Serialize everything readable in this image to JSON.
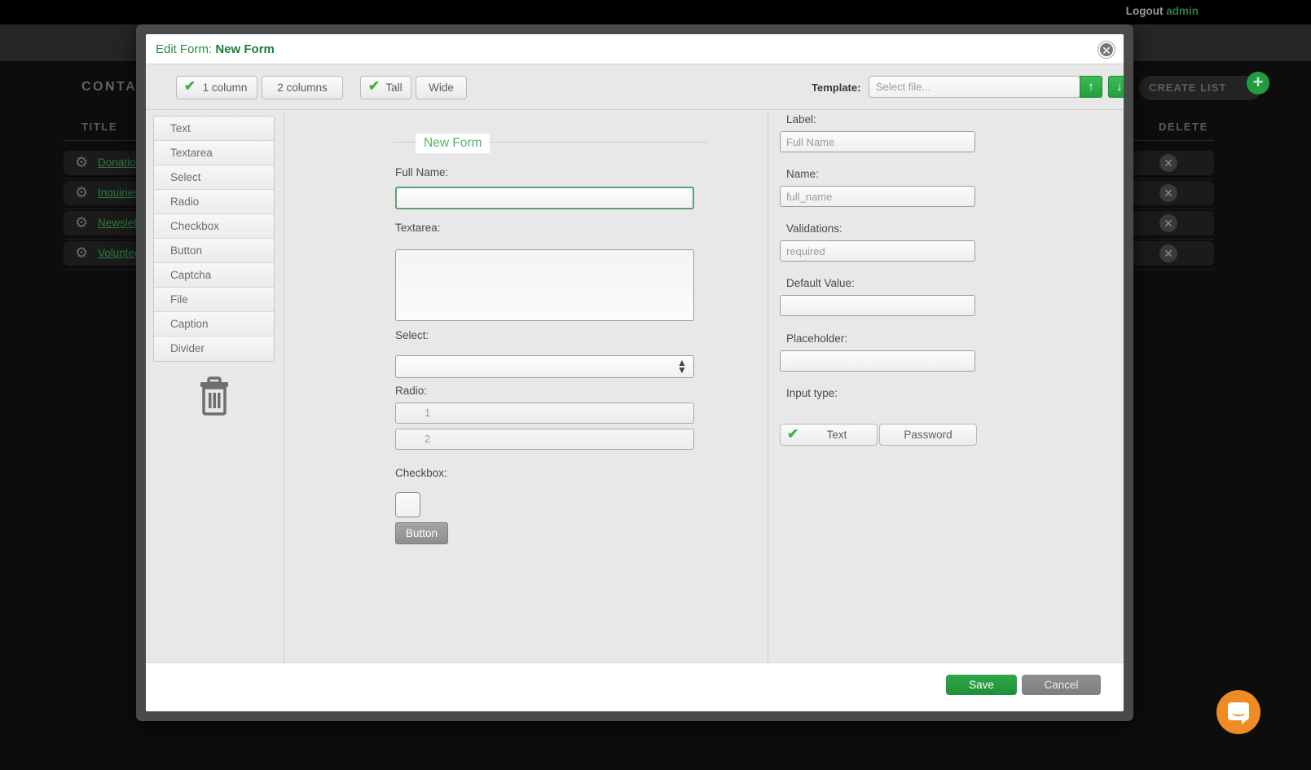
{
  "background": {
    "logout_label": "Logout",
    "username": "admin",
    "page_title": "CONTACT",
    "create_list_label": "CREATE LIST",
    "plus_icon": "plus-icon",
    "columns": {
      "title": "TITLE",
      "delete": "DELETE"
    },
    "rows": [
      {
        "name": "Donation F",
        "gear": "gear-icon",
        "delete": "x"
      },
      {
        "name": "Inquiries",
        "gear": "gear-icon",
        "delete": "x"
      },
      {
        "name": "Newsletter",
        "gear": "gear-icon",
        "delete": "x"
      },
      {
        "name": "Volunteer F",
        "gear": "gear-icon",
        "delete": "x"
      }
    ]
  },
  "modal": {
    "title_prefix": "Edit Form: ",
    "title_value": "New Form",
    "close_icon": "✕",
    "toolbar": {
      "one_column": "1 column",
      "two_columns": "2 columns",
      "tall": "Tall",
      "wide": "Wide",
      "check_glyph": "✔",
      "template_label": "Template:",
      "template_placeholder": "Select file...",
      "template_value": "",
      "upload_icon": "↑",
      "download_icon": "↓"
    },
    "palette": {
      "items": [
        {
          "label": "Text"
        },
        {
          "label": "Textarea"
        },
        {
          "label": "Select"
        },
        {
          "label": "Radio"
        },
        {
          "label": "Checkbox"
        },
        {
          "label": "Button"
        },
        {
          "label": "Captcha"
        },
        {
          "label": "File"
        },
        {
          "label": "Caption"
        },
        {
          "label": "Divider"
        }
      ],
      "trash_icon": "trash-icon"
    },
    "canvas": {
      "legend": "New Form",
      "full_name_label": "Full Name:",
      "full_name_value": "",
      "textarea_label": "Textarea:",
      "textarea_value": "",
      "select_label": "Select:",
      "select_value": "",
      "radio_label": "Radio:",
      "radio_options": [
        "1",
        "2"
      ],
      "checkbox_label": "Checkbox:",
      "button_label": "Button"
    },
    "properties": {
      "label_label": "Label:",
      "label_placeholder": "Full Name",
      "label_value": "",
      "name_label": "Name:",
      "name_placeholder": "full_name",
      "name_value": "",
      "validations_label": "Validations:",
      "validations_placeholder": "required",
      "validations_value": "",
      "default_value_label": "Default Value:",
      "default_value": "",
      "placeholder_label": "Placeholder:",
      "placeholder_value": "",
      "input_type_label": "Input type:",
      "type_text": "Text",
      "type_password": "Password",
      "check_glyph": "✔"
    },
    "footer": {
      "save_label": "Save",
      "cancel_label": "Cancel"
    }
  },
  "chat": {
    "icon": "chat-bubble-icon"
  }
}
